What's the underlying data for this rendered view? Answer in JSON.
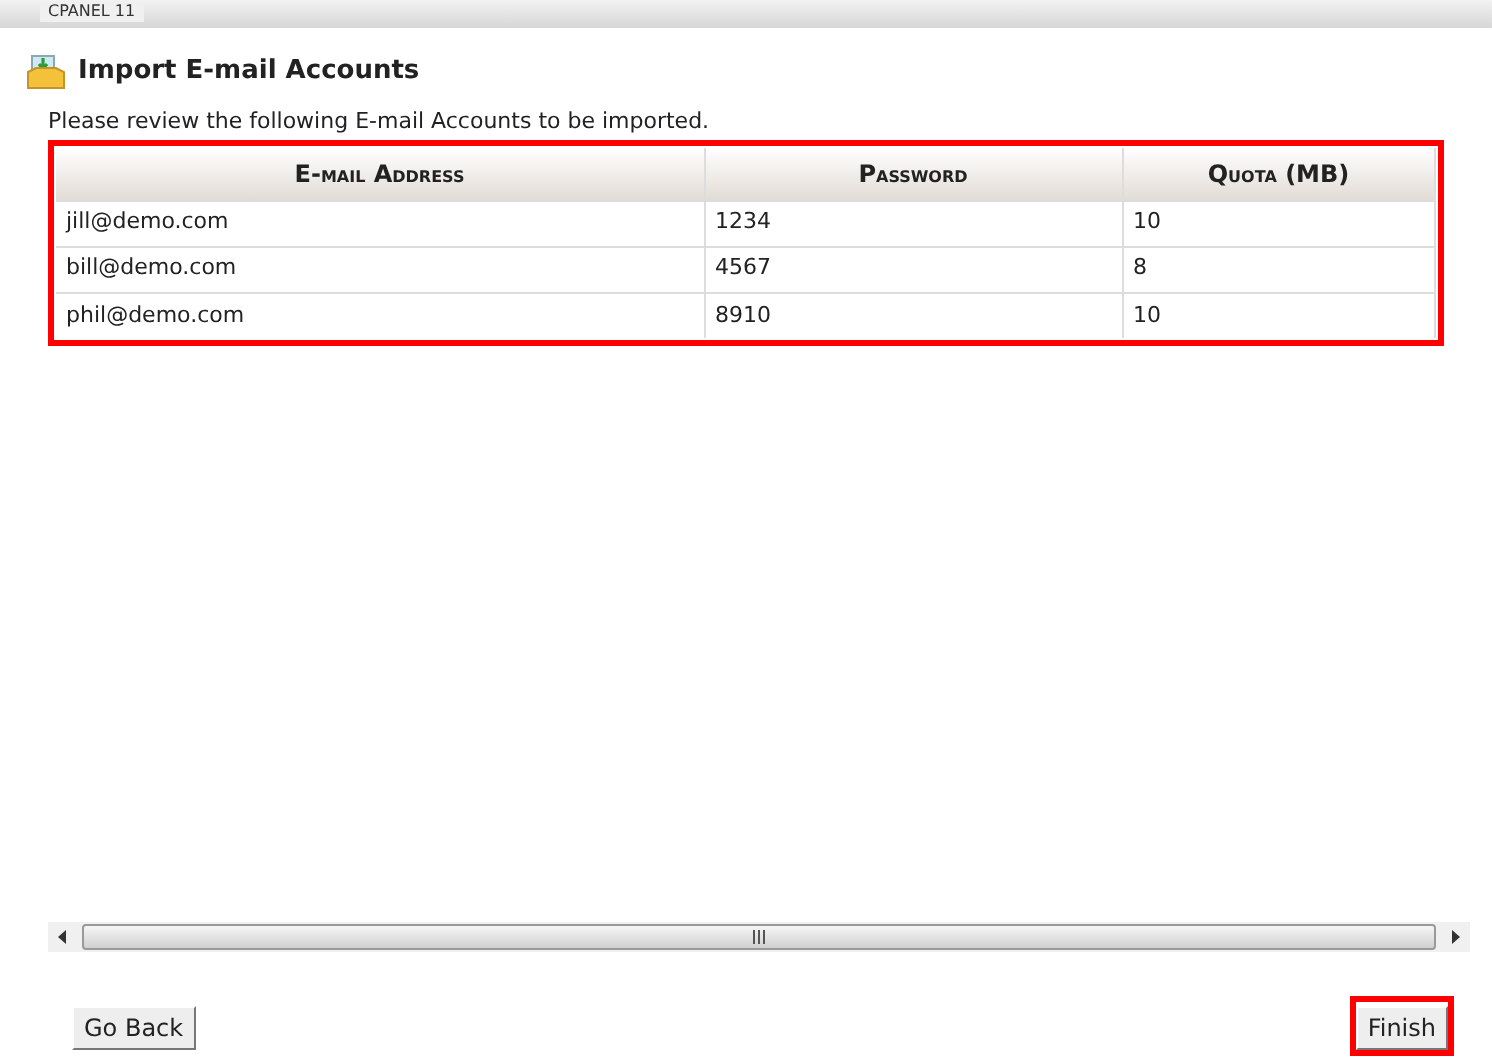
{
  "header": {
    "title": "CPANEL 11"
  },
  "page": {
    "title": "Import E-mail Accounts",
    "description": "Please review the following E-mail Accounts to be imported."
  },
  "table": {
    "highlighted": true,
    "columns": [
      "E-mail Address",
      "Password",
      "Quota (MB)"
    ],
    "rows": [
      {
        "cells": [
          "jill@demo.com",
          "1234",
          "10"
        ]
      },
      {
        "cells": [
          "bill@demo.com",
          "4567",
          "8"
        ]
      },
      {
        "cells": [
          "phil@demo.com",
          "8910",
          "10"
        ]
      }
    ]
  },
  "buttons": [
    {
      "label": "Go Back",
      "highlighted": false
    },
    {
      "label": "Finish",
      "highlighted": true
    }
  ]
}
